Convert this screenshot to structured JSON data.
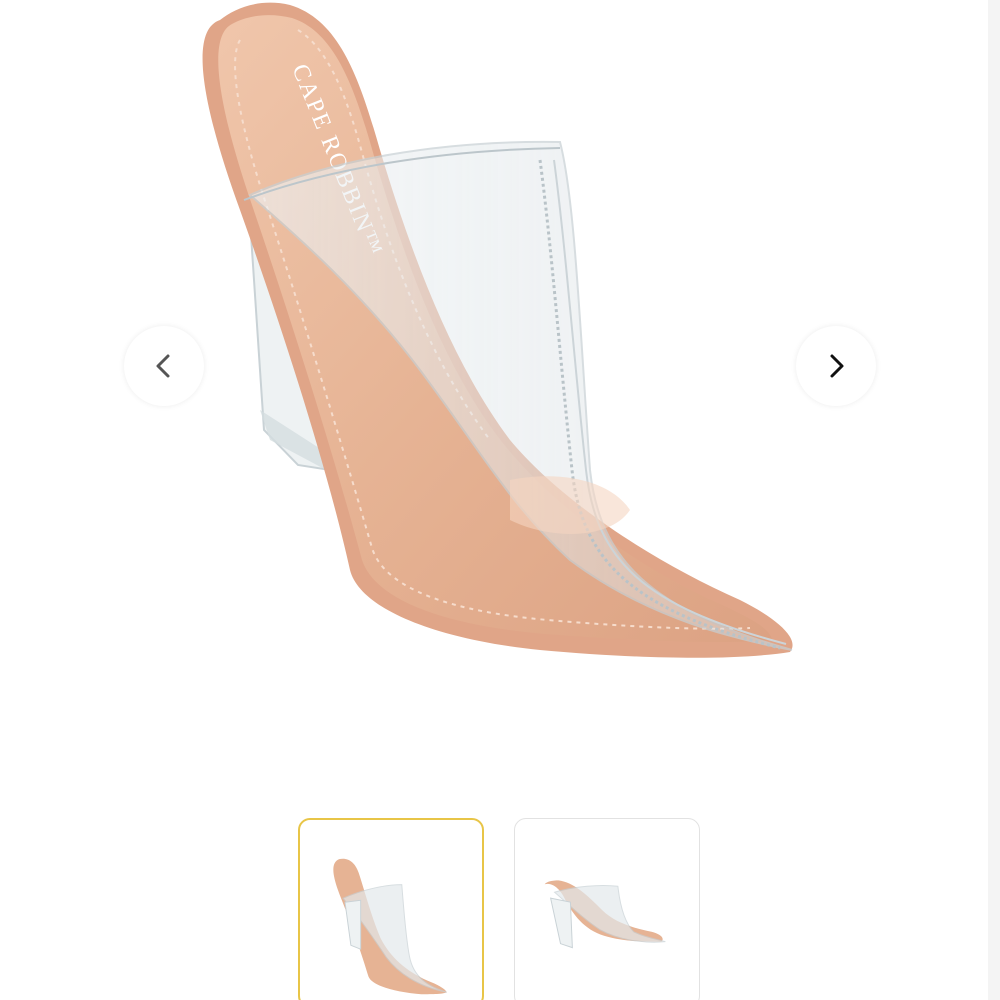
{
  "product": {
    "brand_mark": "CAPE ROBBIN™"
  },
  "gallery": {
    "prev_icon": "chevron-left-icon",
    "next_icon": "chevron-right-icon",
    "prev_color": "#555555",
    "next_color": "#111111",
    "thumbnails": [
      {
        "label": "view-1",
        "selected": true
      },
      {
        "label": "view-2",
        "selected": false
      }
    ],
    "selected_border_color": "#e8c547"
  },
  "colors": {
    "insole": "#e7b496",
    "insole_shadow": "#d59c7c",
    "vinyl": "#dfe6ea"
  }
}
